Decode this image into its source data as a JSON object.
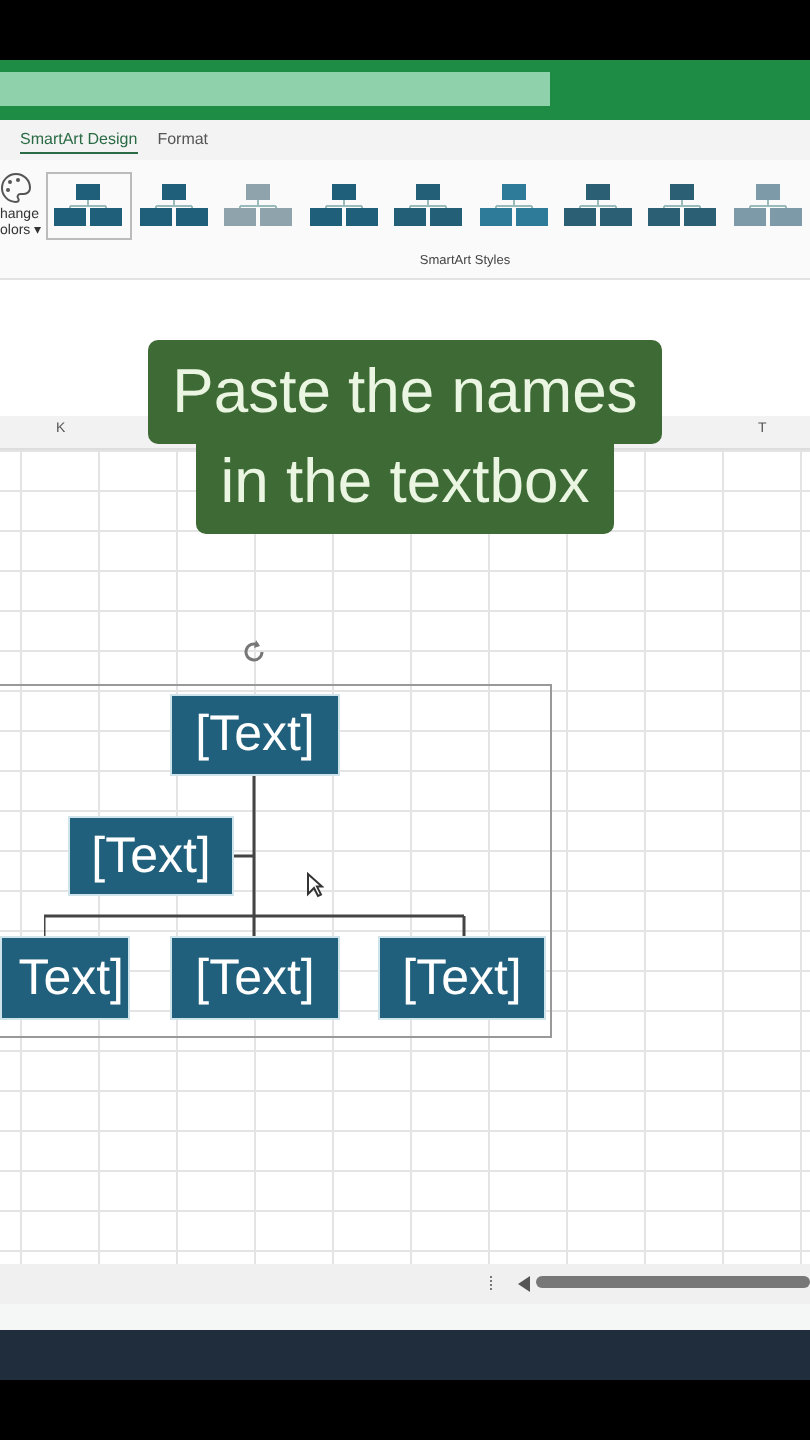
{
  "ribbon_tabs": [
    {
      "label": "SmartArt Design",
      "selected": true
    },
    {
      "label": "Format",
      "selected": false
    }
  ],
  "change_colors": {
    "lines": [
      "hange",
      "olors ▾"
    ]
  },
  "smartart_styles": [
    {
      "selected": true,
      "color": "#1f5f7a"
    },
    {
      "selected": false,
      "color": "#1f5f7a"
    },
    {
      "selected": false,
      "color": "#8fa3ad"
    },
    {
      "selected": false,
      "color": "#1f5f7a"
    },
    {
      "selected": false,
      "color": "#245f78"
    },
    {
      "selected": false,
      "color": "#2e7b99"
    },
    {
      "selected": false,
      "color": "#2b5f73"
    },
    {
      "selected": false,
      "color": "#2b5f73"
    },
    {
      "selected": false,
      "color": "#7d9aa8"
    }
  ],
  "group_label": "SmartArt Styles",
  "column_headers": [
    "K",
    "T"
  ],
  "caption_lines": [
    "Paste the names",
    "in the textbox"
  ],
  "org_chart": {
    "top": "[Text]",
    "assistant": "[Text]",
    "children": [
      "Text]",
      "[Text]",
      "[Text]"
    ]
  }
}
